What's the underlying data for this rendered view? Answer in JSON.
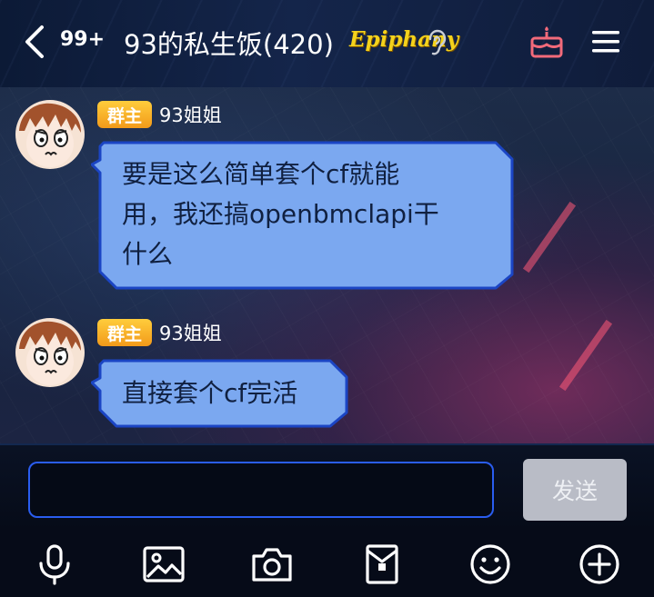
{
  "header": {
    "unread_count": "99+",
    "group_title": "93的私生饭(420)",
    "title_badge": "Epiphany",
    "icons": {
      "back": "chevron-left-icon",
      "ear": "ear-icon",
      "gift": "cake-icon",
      "menu": "hamburger-menu-icon"
    }
  },
  "messages": [
    {
      "role_badge": "群主",
      "sender": "93姐姐",
      "text": "要是这么简单套个cf就能\n用，我还搞openbmclapi干\n什么"
    },
    {
      "role_badge": "群主",
      "sender": "93姐姐",
      "text": "直接套个cf完活"
    }
  ],
  "composer": {
    "value": "",
    "send_label": "发送"
  },
  "toolbar": {
    "items": [
      "microphone-icon",
      "image-icon",
      "camera-icon",
      "red-packet-icon",
      "emoji-icon",
      "plus-icon"
    ]
  },
  "colors": {
    "bubble_fill": "#7ba8f0",
    "bubble_border": "#1b45c4",
    "accent_blue": "#2a5df0",
    "owner_badge": "#f7ad22",
    "send_disabled": "#b9bcc6"
  }
}
